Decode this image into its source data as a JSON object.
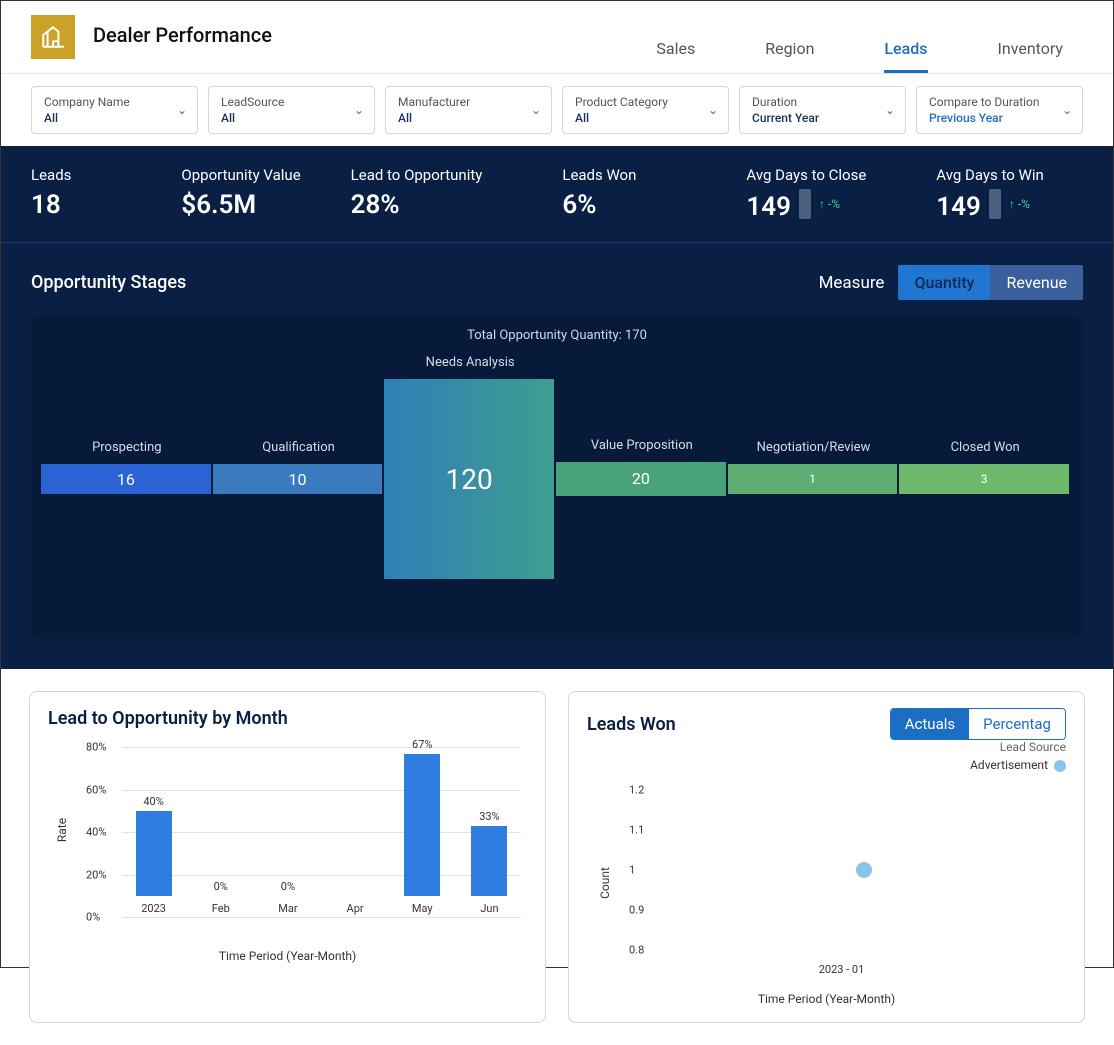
{
  "header": {
    "title": "Dealer Performance",
    "tabs": [
      "Sales",
      "Region",
      "Leads",
      "Inventory"
    ],
    "active_tab": 2
  },
  "filters": [
    {
      "label": "Company Name",
      "value": "All"
    },
    {
      "label": "LeadSource",
      "value": "All"
    },
    {
      "label": "Manufacturer",
      "value": "All"
    },
    {
      "label": "Product Category",
      "value": "All"
    },
    {
      "label": "Duration",
      "value": "Current Year"
    },
    {
      "label": "Compare to Duration",
      "value": "Previous Year",
      "compare": true
    }
  ],
  "kpis": {
    "leads": {
      "label": "Leads",
      "value": "18"
    },
    "opp_value": {
      "label": "Opportunity Value",
      "value": "$6.5M"
    },
    "lead_to_opp": {
      "label": "Lead to Opportunity",
      "value": "28%"
    },
    "leads_won": {
      "label": "Leads Won",
      "value": "6%"
    },
    "avg_close": {
      "label": "Avg Days to Close",
      "value": "149",
      "delta": "↑ -%"
    },
    "avg_win": {
      "label": "Avg Days to Win",
      "value": "149",
      "delta": "↑ -%"
    }
  },
  "stages": {
    "title": "Opportunity Stages",
    "measure_label": "Measure",
    "seg": {
      "quantity": "Quantity",
      "revenue": "Revenue",
      "active": "quantity"
    },
    "total_label": "Total Opportunity Quantity: 170"
  },
  "chart_data": [
    {
      "id": "funnel",
      "type": "funnel",
      "title": "Opportunity Stages",
      "stages": [
        {
          "name": "Prospecting",
          "value": 16
        },
        {
          "name": "Qualification",
          "value": 10
        },
        {
          "name": "Needs Analysis",
          "value": 120
        },
        {
          "name": "Value Proposition",
          "value": 20
        },
        {
          "name": "Negotiation/Review",
          "value": 1
        },
        {
          "name": "Closed Won",
          "value": 3
        }
      ],
      "total": 170
    },
    {
      "id": "lead_to_opp_month",
      "type": "bar",
      "title": "Lead to Opportunity by Month",
      "xlabel": "Time Period (Year-Month)",
      "ylabel": "Rate",
      "ylim": [
        0,
        80
      ],
      "yticks": [
        0,
        20,
        40,
        60,
        80
      ],
      "categories": [
        "2023",
        "Feb",
        "Mar",
        "Apr",
        "May",
        "Jun"
      ],
      "values": [
        40,
        0,
        0,
        0,
        67,
        33
      ],
      "value_labels": [
        "40%",
        "0%",
        "0%",
        "",
        "67%",
        "33%"
      ]
    },
    {
      "id": "leads_won",
      "type": "scatter",
      "title": "Leads Won",
      "xlabel": "Time Period (Year-Month)",
      "ylabel": "Count",
      "ylim": [
        0.8,
        1.2
      ],
      "yticks": [
        0.8,
        0.9,
        1,
        1.1,
        1.2
      ],
      "legend_title": "Lead Source",
      "series": [
        {
          "name": "Advertisement",
          "points": [
            {
              "x": "2023 - 01",
              "y": 1
            }
          ]
        }
      ],
      "seg": {
        "actuals": "Actuals",
        "percentage": "Percentag",
        "active": "actuals"
      }
    }
  ]
}
